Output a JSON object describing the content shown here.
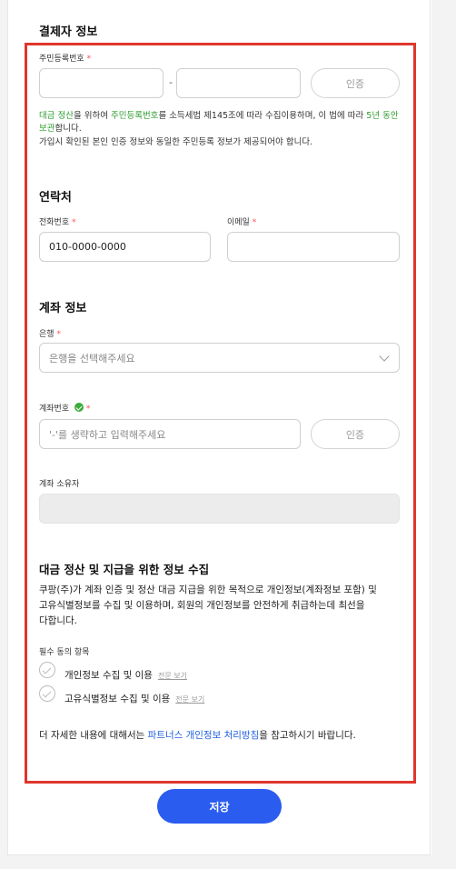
{
  "payer_section": {
    "title": "결제자 정보"
  },
  "resident_id": {
    "label": "주민등록번호",
    "required_mark": "*",
    "front_value": "",
    "back_value": "",
    "separator": "-",
    "verify_label": "인증",
    "note_parts": [
      "대금 정산",
      "을 위하여 ",
      "주민등록번호",
      "를 소득세법 제145조에 따라 수집이용하며, 이 법에 따라 ",
      "5년 동안 보관",
      "합니다."
    ],
    "note_line2": "가입시 확인된 본인 인증 정보와 동일한 주민등록 정보가 제공되어야 합니다."
  },
  "contact": {
    "title": "연락처",
    "phone_label": "전화번호",
    "phone_value": "010-0000-0000",
    "email_label": "이메일",
    "email_value": "",
    "required_mark": "*"
  },
  "account": {
    "title": "계좌 정보",
    "bank_label": "은행",
    "bank_placeholder": "은행을 선택해주세요",
    "number_label": "계좌번호",
    "number_placeholder": "'-'를 생략하고 입력해주세요",
    "verify_label": "인증",
    "holder_label": "계좌 소유자",
    "holder_value": "",
    "required_mark": "*"
  },
  "consent": {
    "title": "대금 정산 및 지급을 위한 정보 수집",
    "desc_line1": "쿠팡(주)가 계좌 인증 및 정산 대금 지급을 위한 목적으로 개인정보(계좌정보 포함) 및",
    "desc_line2": "고유식별정보를 수집 및 이용하며, 회원의 개인정보를 안전하게 취급하는데 최선을",
    "desc_line3": "다합니다.",
    "required_heading": "필수 동의 항목",
    "items": [
      {
        "label": "개인정보 수집 및 이용",
        "link": "전문 보기"
      },
      {
        "label": "고유식별정보 수집 및 이용",
        "link": "전문 보기"
      }
    ],
    "footer_prefix": "더 자세한 내용에 대해서는 ",
    "footer_link": "파트너스 개인정보 처리방침",
    "footer_suffix": "을 참고하시기 바랍니다."
  },
  "save_label": "저장",
  "colors": {
    "accent": "#2a5cf0",
    "highlight": "#e0362c",
    "green": "#2f9d2f"
  }
}
